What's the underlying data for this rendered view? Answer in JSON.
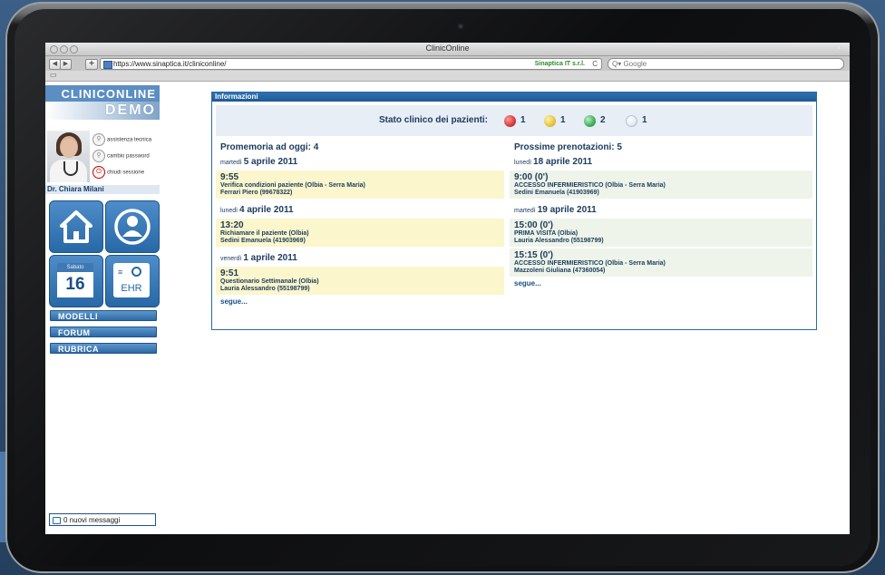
{
  "browser": {
    "window_title": "ClinicOnline",
    "url": "https://www.sinaptica.it/cliniconline/",
    "site_identity": "Sinaptica IT s.r.l.",
    "search_placeholder": "Q▾ Google",
    "back": "◀",
    "forward": "▶",
    "add": "+",
    "reload": "C"
  },
  "sidebar": {
    "logo": "CLINICONLINE",
    "demo": "DEMO",
    "links": [
      {
        "label": "assistenza tecnica",
        "icon": "key-icon"
      },
      {
        "label": "cambio password",
        "icon": "key-icon"
      },
      {
        "label": "chiudi sessione",
        "icon": "power-icon"
      }
    ],
    "doctor_name": "Dr. Chiara Milani",
    "calendar": {
      "weekday": "Sabato",
      "day": "16"
    },
    "ehr_label": "EHR",
    "menu": [
      "MODELLI",
      "FORUM",
      "RUBRICA"
    ],
    "messages": "0 nuovi messaggi"
  },
  "panel": {
    "title": "Informazioni",
    "status_label": "Stato clinico dei pazienti:",
    "status": [
      {
        "color": "#d83a3a",
        "count": "1"
      },
      {
        "color": "#e6c43a",
        "count": "1"
      },
      {
        "color": "#3fae5a",
        "count": "2"
      },
      {
        "color": "#e4ecf4",
        "count": "1"
      }
    ],
    "reminders": {
      "title": "Promemoria ad oggi: 4",
      "more": "segue...",
      "days": [
        {
          "weekday": "martedì",
          "date": "5 aprile 2011",
          "items": [
            {
              "time": "9:55",
              "desc": "Verifica condizioni paziente (Olbia - Serra Maria)",
              "patient": "Ferrari Piero (99678322)"
            }
          ]
        },
        {
          "weekday": "lunedì",
          "date": "4 aprile 2011",
          "items": [
            {
              "time": "13:20",
              "desc": "Richiamare il paziente (Olbia)",
              "patient": "Sedini Emanuela (41903969)"
            }
          ]
        },
        {
          "weekday": "venerdì",
          "date": "1 aprile 2011",
          "items": [
            {
              "time": "9:51",
              "desc": "Questionario Settimanale (Olbia)",
              "patient": "Lauria Alessandro (55198799)"
            }
          ]
        }
      ]
    },
    "bookings": {
      "title": "Prossime prenotazioni: 5",
      "more": "segue...",
      "days": [
        {
          "weekday": "lunedì",
          "date": "18 aprile 2011",
          "items": [
            {
              "time": "9:00 (0')",
              "desc": "ACCESSO INFERMIERISTICO (Olbia - Serra Maria)",
              "patient": "Sedini Emanuela (41903969)"
            }
          ]
        },
        {
          "weekday": "martedì",
          "date": "19 aprile 2011",
          "items": [
            {
              "time": "15:00 (0')",
              "desc": "PRIMA VISITA (Olbia)",
              "patient": "Lauria Alessandro (55198799)"
            },
            {
              "time": "15:15 (0')",
              "desc": "ACCESSO INFERMIERISTICO (Olbia - Serra Maria)",
              "patient": "Mazzoleni Giuliana (47360054)"
            }
          ]
        }
      ]
    }
  }
}
